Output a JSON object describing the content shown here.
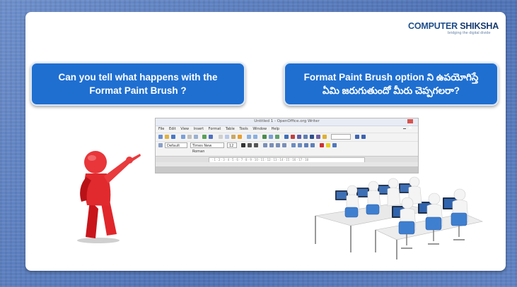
{
  "logo": {
    "name_part1": "COMPUTER",
    "name_part2": " SHIKSHA",
    "tagline": "bridging the digital divide"
  },
  "question_en": {
    "line1": "Can you tell what happens with the",
    "line2": "Format Paint Brush ?"
  },
  "question_te": {
    "line1": "Format Paint Brush option ని ఉపయోగిస్తే",
    "line2": "ఏమి జరుగుతుందో మీరు చెప్పగలరా?"
  },
  "writer_window": {
    "title": "Untitled 1 - OpenOffice.org Writer",
    "menu": [
      "File",
      "Edit",
      "View",
      "Insert",
      "Format",
      "Table",
      "Tools",
      "Window",
      "Help"
    ],
    "style_value": "Default",
    "font_value": "Times New Roman",
    "size_value": "12",
    "ruler_text": "· 1 · 2 · 3 · 4 · 5 · 6 · 7 · 8 · 9 · 10 · 11 · 12 · 13 · 14 · 15 · 16 · 17 · 18"
  },
  "colors": {
    "bubble": "#1f6fd1",
    "background": "#5b7fbf",
    "logo_text": "#1f4f8a"
  }
}
